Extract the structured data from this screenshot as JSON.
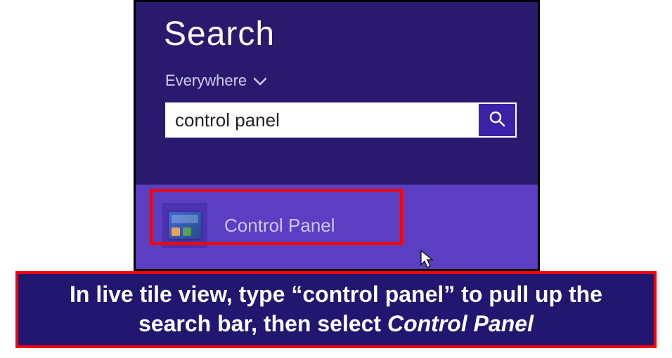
{
  "search": {
    "title": "Search",
    "scope_label": "Everywhere",
    "query": "control panel",
    "placeholder": ""
  },
  "result": {
    "label": "Control Panel"
  },
  "caption": {
    "pre": "In live tile view, type “control panel” to pull up the search bar, then select ",
    "em": "Control Panel"
  }
}
